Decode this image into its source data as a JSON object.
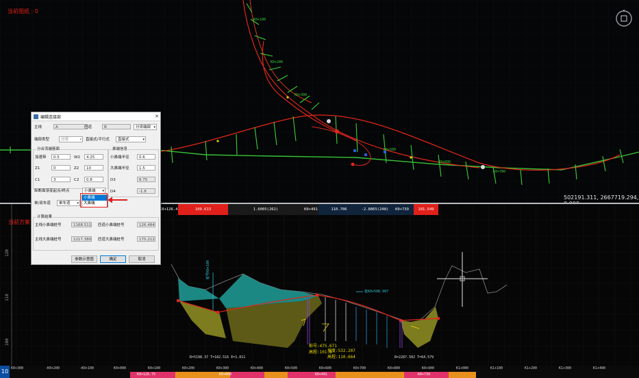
{
  "plan": {
    "top_left_label": "当前图纸 : 0",
    "coordinates": "502191.311, 2667719.294, 0.000"
  },
  "profile": {
    "top_left_label": "当前方案",
    "elevations": [
      "120",
      "110",
      "100"
    ],
    "curve_left": "R=5198.37 T=182.516 E=1.011",
    "curve_right": "R=2287.502 T=64.579",
    "annotations": [
      "桩号:475.671",
      "高程:101.8",
      "坡度:532.207",
      "高程:110.664"
    ],
    "point_labels": [
      "桩K0+508.907",
      "桩号K0+100"
    ]
  },
  "band": {
    "segments": [
      {
        "text": "K0+126.484",
        "color": "#000000"
      },
      {
        "text": "109.613",
        "color": "#e0201a"
      },
      {
        "text": "1.6005(262)",
        "color": "#1a1a1a"
      },
      {
        "text": "K0+491",
        "color": "#1a1a1a"
      },
      {
        "text": "110.706",
        "color": "#10243c"
      },
      {
        "text": "-2.8865(248)",
        "color": "#10243c"
      },
      {
        "text": "K0+739",
        "color": "#10243c"
      },
      {
        "text": "101.549",
        "color": "#e0201a"
      }
    ]
  },
  "chainage": {
    "number": "10",
    "ticks": [
      "K0+300",
      "-K0+200",
      "-K0+100",
      "K0+000",
      "K0+100",
      "K0+200",
      "K0+300",
      "K0+400",
      "K0+500",
      "K0+600",
      "K0+700",
      "K0+800",
      "K0+900",
      "K1+000",
      "K1+100",
      "K1+200",
      "K1+300",
      "K1+400"
    ],
    "band_labels": [
      "K0+126.75",
      "K0+000",
      "K0+491",
      "K0+739"
    ]
  },
  "dialog": {
    "title": "编辑连接部",
    "close_glyph": "✕",
    "row1": {
      "main_label": "主线",
      "main_value": "A",
      "ramp_label": "匝道",
      "ramp_value": "B",
      "type_value": "分流端部"
    },
    "row2": {
      "label": "端部类型",
      "value1": "分流",
      "value2": "直接式/平行式",
      "value3": "直接式"
    },
    "group1": {
      "title": "分合流端筋面",
      "fields": [
        {
          "label": "加速带",
          "value": "0.5"
        },
        {
          "label": "W2",
          "value": "4.25"
        },
        {
          "label": "Z1",
          "value": "0"
        },
        {
          "label": "Z2",
          "value": "10"
        },
        {
          "label": "C1",
          "value": "3"
        },
        {
          "label": "C2",
          "value": "0.8"
        }
      ]
    },
    "group2": {
      "title": "鼻端信息",
      "fields": [
        {
          "label": "小鼻端半径",
          "value": "0.6"
        },
        {
          "label": "大鼻端半径",
          "value": "1.5"
        },
        {
          "label": "D3",
          "value": "6.75"
        },
        {
          "label": "D4",
          "value": "-1.8"
        }
      ]
    },
    "start_label": "纵断面渐变起点/终点",
    "start_value": "小鼻端",
    "lane_label": "单/双车道",
    "lane_value": "单车道",
    "dropdown_options": [
      "小鼻端",
      "大鼻端"
    ],
    "result": {
      "title": "计算结果",
      "fields": [
        {
          "label": "主线小鼻端桩号",
          "value": "1168.5118"
        },
        {
          "label": "匝道小鼻端桩号",
          "value": "126.4844"
        },
        {
          "label": "主线大鼻端桩号",
          "value": "1217.3803"
        },
        {
          "label": "匝道大鼻端桩号",
          "value": "175.2124"
        }
      ]
    },
    "buttons": {
      "diagram": "参数示意图",
      "ok": "确定",
      "cancel": "取消"
    }
  }
}
